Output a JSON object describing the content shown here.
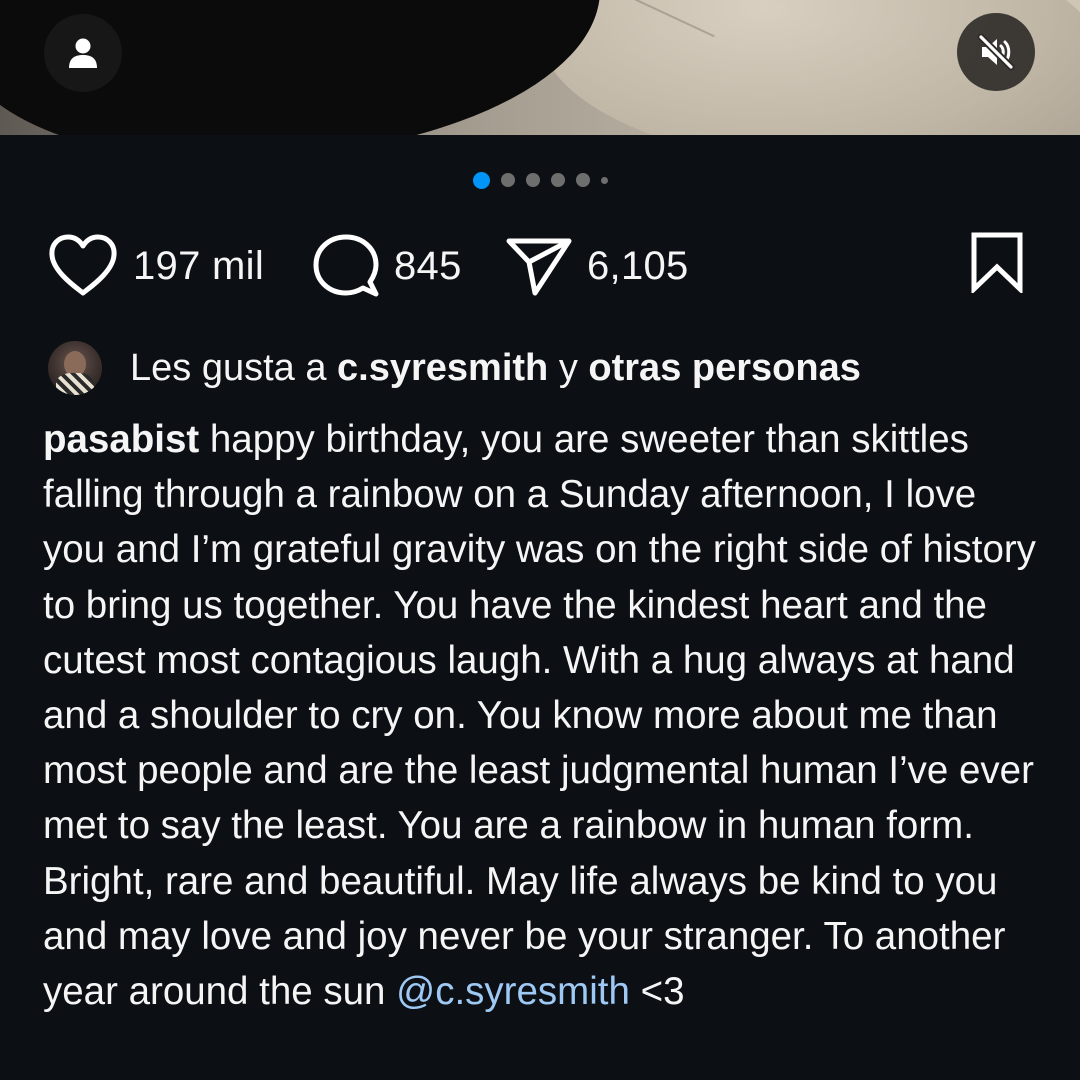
{
  "post": {
    "carousel": {
      "total_dots": 6,
      "active_index": 0
    },
    "actions": {
      "like_count": "197 mil",
      "comment_count": "845",
      "share_count": "6,105"
    },
    "liked_by": {
      "prefix": "Les gusta a ",
      "user": "c.syresmith",
      "connector": " y ",
      "others": "otras personas"
    },
    "caption": {
      "username": "pasabist",
      "text": " happy birthday, you are sweeter than skittles falling through a rainbow on a Sunday afternoon, I love you and I’m grateful gravity was on the right side of history to bring us together. You have the kindest heart and the cutest most contagious laugh. With a hug always at hand and a shoulder to cry on. You know more about me than most people and are the least judgmental human I’ve ever met to say the least. You are a rainbow in human form. Bright, rare and beautiful. May life always be kind to you and may love and joy never be your stranger. To another year around the sun ",
      "mention": "@c.syresmith",
      "suffix": " <3"
    }
  },
  "icons": {
    "tag": "user-tag-icon",
    "mute": "speaker-muted-icon",
    "like": "heart-icon",
    "comment": "comment-bubble-icon",
    "share": "paper-plane-icon",
    "save": "bookmark-icon"
  },
  "colors": {
    "background": "#0c1014",
    "text": "#f5f5f5",
    "active_dot": "#0095f6",
    "inactive_dot": "#6e6e6e",
    "mention": "#9ec9f4"
  }
}
